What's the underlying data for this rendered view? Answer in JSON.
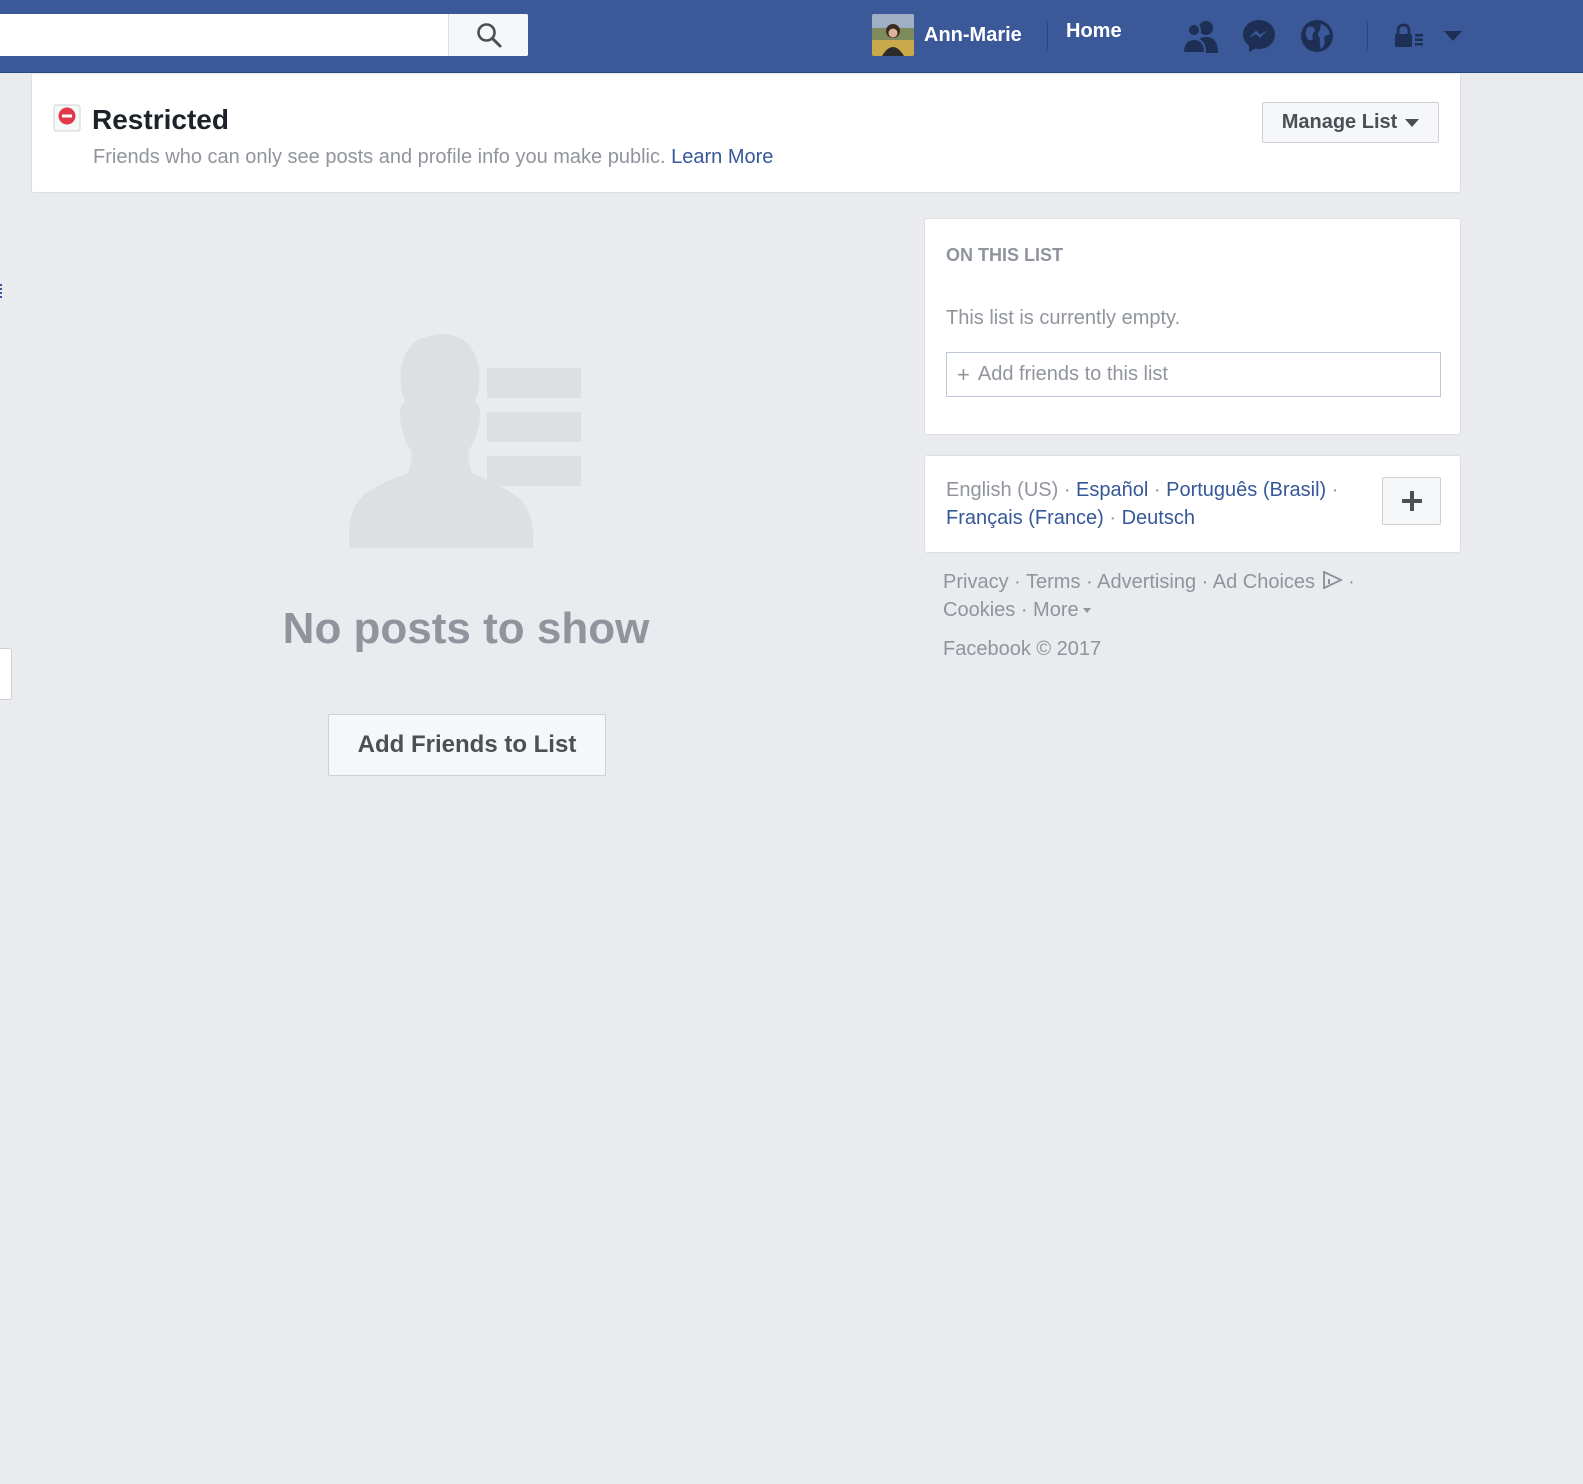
{
  "topbar": {
    "search_placeholder": "",
    "user_name": "Ann-Marie",
    "home_label": "Home",
    "bg_color": "#3b5998"
  },
  "list_header": {
    "title": "Restricted",
    "description": "Friends who can only see posts and profile info you make public.",
    "learn_more": "Learn More",
    "manage_button": "Manage List"
  },
  "main": {
    "empty_title": "No posts to show",
    "add_button": "Add Friends to List"
  },
  "sidebar": {
    "heading": "ON THIS LIST",
    "empty_message": "This list is currently empty.",
    "add_placeholder": "Add friends to this list"
  },
  "languages": {
    "current": "English (US)",
    "items": [
      "Español",
      "Português (Brasil)",
      "Français (France)",
      "Deutsch"
    ],
    "separator": " · "
  },
  "footer": {
    "links": [
      "Privacy",
      "Terms",
      "Advertising",
      "Ad Choices",
      "Cookies",
      "More"
    ],
    "copyright": "Facebook © 2017"
  },
  "colors": {
    "link": "#365899",
    "muted": "#90949c",
    "page_bg": "#e9ebee",
    "restricted_red": "#e0394c"
  }
}
